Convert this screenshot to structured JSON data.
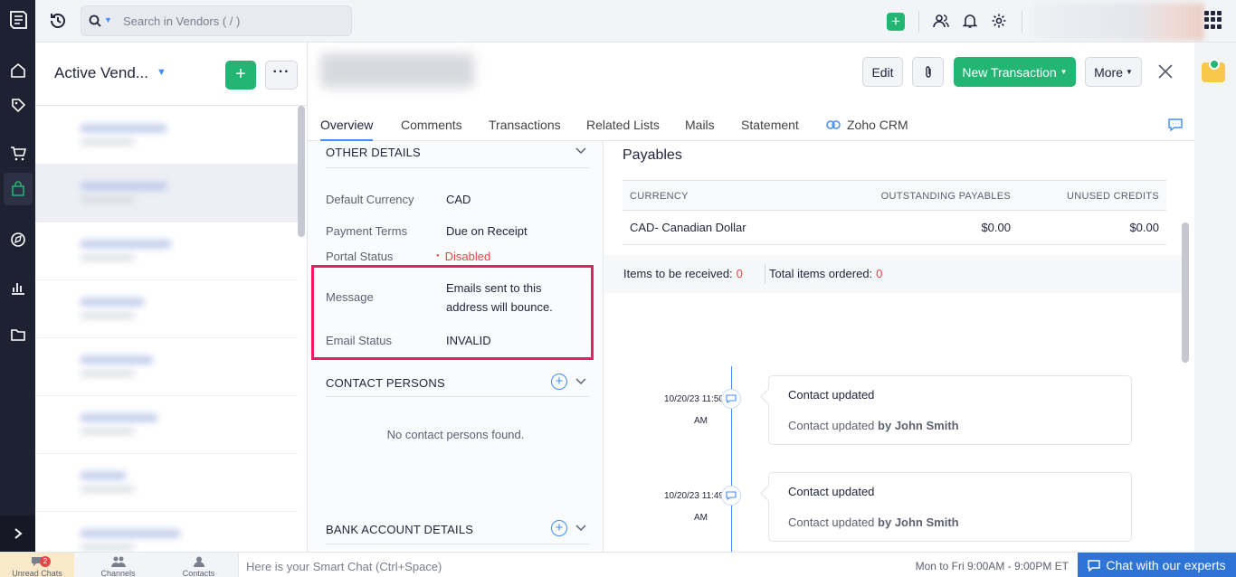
{
  "search": {
    "placeholder": "Search in Vendors ( / )"
  },
  "list": {
    "title": "Active Vend...",
    "add_label": "+",
    "more_label": "···"
  },
  "detail": {
    "buttons": {
      "edit": "Edit",
      "new_transaction": "New Transaction",
      "more": "More"
    },
    "tabs": [
      "Overview",
      "Comments",
      "Transactions",
      "Related Lists",
      "Mails",
      "Statement",
      "Zoho CRM"
    ]
  },
  "other_details": {
    "heading": "OTHER DETAILS",
    "default_currency_label": "Default Currency",
    "default_currency": "CAD",
    "payment_terms_label": "Payment Terms",
    "payment_terms": "Due on Receipt",
    "portal_status_label": "Portal Status",
    "portal_status": "Disabled",
    "message_label": "Message",
    "message_line1": "Emails sent to this",
    "message_line2": "address will bounce.",
    "email_status_label": "Email Status",
    "email_status": "INVALID"
  },
  "contact_persons": {
    "heading": "CONTACT PERSONS",
    "empty": "No contact persons found."
  },
  "bank_details": {
    "heading": "BANK ACCOUNT DETAILS"
  },
  "payables": {
    "heading": "Payables",
    "columns": [
      "CURRENCY",
      "OUTSTANDING PAYABLES",
      "UNUSED CREDITS"
    ],
    "rows": [
      {
        "currency": "CAD- Canadian Dollar",
        "outstanding": "$0.00",
        "unused": "$0.00"
      }
    ],
    "items_received_label": "Items to be received:",
    "items_received": "0",
    "total_ordered_label": "Total items ordered:",
    "total_ordered": "0"
  },
  "timeline": [
    {
      "date": "10/20/23 11:50",
      "ampm": "AM",
      "title": "Contact updated",
      "desc": "Contact updated",
      "by": "by John Smith"
    },
    {
      "date": "10/20/23 11:49",
      "ampm": "AM",
      "title": "Contact updated",
      "desc": "Contact updated",
      "by": "by John Smith"
    }
  ],
  "bottom": {
    "unread_chats": "Unread Chats",
    "unread_count": "2",
    "channels": "Channels",
    "contacts": "Contacts",
    "smartchat_placeholder": "Here is your Smart Chat (Ctrl+Space)",
    "hours": "Mon to Fri 9:00AM - 9:00PM ET",
    "chat_button": "Chat with our experts"
  },
  "colors": {
    "accent": "#408dfb",
    "green": "#22b573",
    "highlight": "#ec1d63",
    "rail": "#1e2131",
    "danger": "#e54747"
  }
}
